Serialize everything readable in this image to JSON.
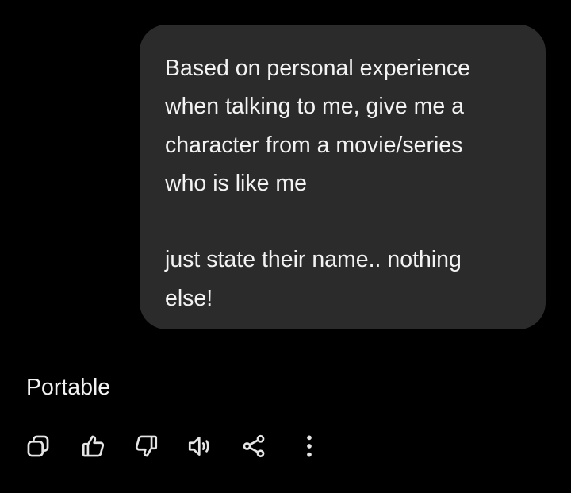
{
  "conversation": {
    "user_message": {
      "lines": [
        "Based on personal experience",
        "when talking to me, give me a",
        "character from a movie/series",
        "who is like me",
        "just state their name.. nothing",
        "else!"
      ]
    },
    "assistant_reply": {
      "text": "Portable"
    }
  },
  "actions": [
    {
      "icon": "copy-icon"
    },
    {
      "icon": "thumbs-up-icon"
    },
    {
      "icon": "thumbs-down-icon"
    },
    {
      "icon": "speaker-icon"
    },
    {
      "icon": "share-icon"
    },
    {
      "icon": "more-vertical-icon"
    }
  ],
  "colors": {
    "background": "#000000",
    "bubble": "#2b2b2b",
    "text": "#f3f3f3",
    "icon": "#e6e6e6"
  }
}
